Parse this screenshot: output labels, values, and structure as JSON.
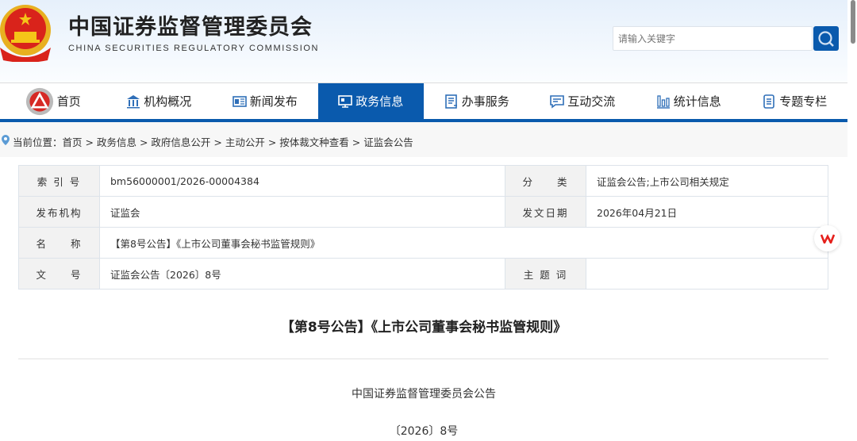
{
  "header": {
    "title": "中国证券监督管理委员会",
    "subtitle": "CHINA SECURITIES REGULATORY COMMISSION",
    "search_placeholder": "请输入关键字"
  },
  "nav": {
    "items": [
      {
        "label": "首页",
        "icon": "csrc-logo-icon"
      },
      {
        "label": "机构概况",
        "icon": "building-icon"
      },
      {
        "label": "新闻发布",
        "icon": "newspaper-icon"
      },
      {
        "label": "政务信息",
        "icon": "monitor-icon",
        "active": true
      },
      {
        "label": "办事服务",
        "icon": "document-list-icon"
      },
      {
        "label": "互动交流",
        "icon": "chat-icon"
      },
      {
        "label": "统计信息",
        "icon": "bar-chart-icon"
      },
      {
        "label": "专题专栏",
        "icon": "file-icon"
      }
    ]
  },
  "breadcrumb": {
    "prefix": "当前位置：",
    "items": [
      "首页",
      "政务信息",
      "政府信息公开",
      "主动公开",
      "按体裁文种查看",
      "证监会公告"
    ],
    "sep": " > "
  },
  "meta": {
    "index_label": "索 引 号",
    "index_value": "bm56000001/2026-00004384",
    "category_label": "分　　类",
    "category_value": "证监会公告;上市公司相关规定",
    "issuer_label": "发布机构",
    "issuer_value": "证监会",
    "date_label": "发文日期",
    "date_value": "2026年04月21日",
    "name_label": "名　　称",
    "name_value": "【第8号公告】《上市公司董事会秘书监管规则》",
    "docno_label": "文　　号",
    "docno_value": "证监会公告〔2026〕8号",
    "keywords_label": "主 题 词",
    "keywords_value": ""
  },
  "document": {
    "title": "【第8号公告】《上市公司董事会秘书监管规则》",
    "issuer_line": "中国证券监督管理委员会公告",
    "number_line": "〔2026〕8号"
  },
  "colors": {
    "brand": "#0a5aad"
  }
}
